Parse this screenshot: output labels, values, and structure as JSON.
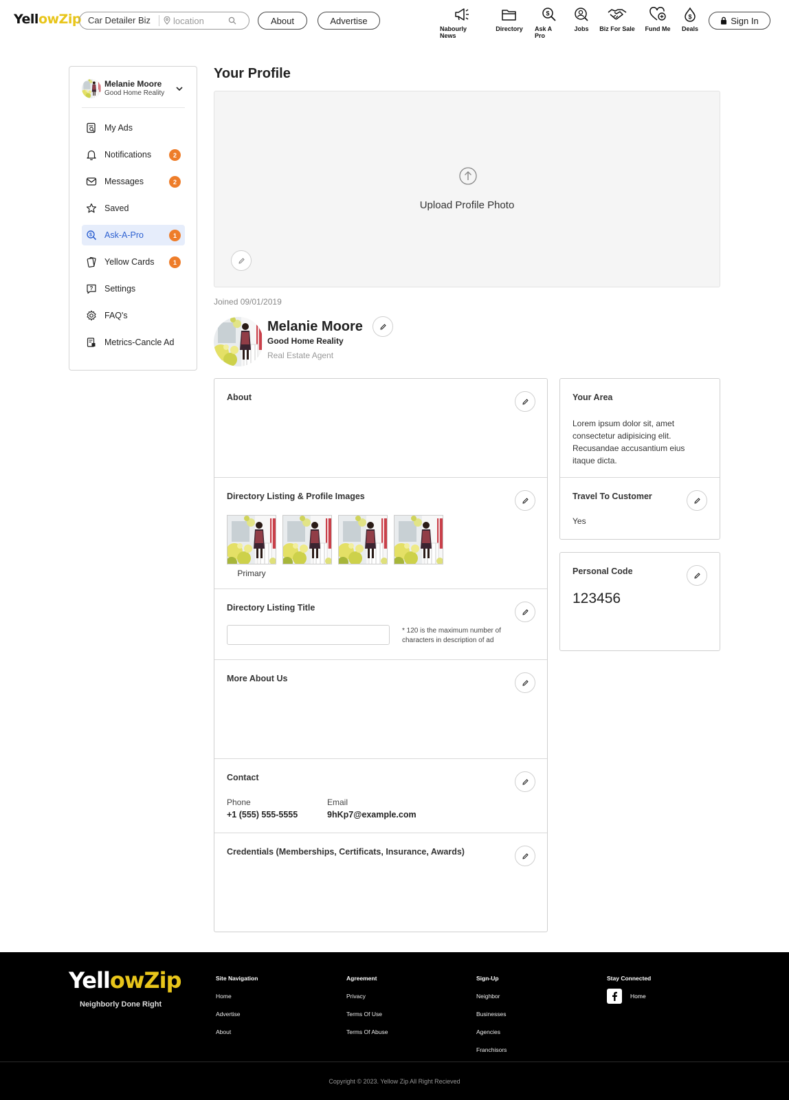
{
  "header": {
    "logo_left": "Yell",
    "logo_mid": "ow",
    "logo_right": "Zip",
    "search_keyword": "Car Detailer Biz",
    "search_location_placeholder": "location",
    "about_label": "About",
    "advertise_label": "Advertise",
    "nav": [
      {
        "label": "Nabourly News",
        "icon": "megaphone-icon"
      },
      {
        "label": "Directory",
        "icon": "folder-icon"
      },
      {
        "label": "Ask A Pro",
        "icon": "dollar-search-icon"
      },
      {
        "label": "Jobs",
        "icon": "user-search-icon"
      },
      {
        "label": "Biz For Sale",
        "icon": "handshake-icon"
      },
      {
        "label": "Fund Me",
        "icon": "heart-plus-icon"
      },
      {
        "label": "Deals",
        "icon": "dollar-drop-icon"
      }
    ],
    "signin_label": "Sign In"
  },
  "sidebar": {
    "user_name": "Melanie Moore",
    "user_company": "Good Home Reality",
    "items": [
      {
        "label": "My Ads",
        "icon": "ads-icon",
        "badge": null,
        "active": false
      },
      {
        "label": "Notifications",
        "icon": "bell-icon",
        "badge": "2",
        "active": false
      },
      {
        "label": "Messages",
        "icon": "envelope-icon",
        "badge": "2",
        "active": false
      },
      {
        "label": "Saved",
        "icon": "star-icon",
        "badge": null,
        "active": false
      },
      {
        "label": "Ask-A-Pro",
        "icon": "dollar-search-icon",
        "badge": "1",
        "active": true
      },
      {
        "label": "Yellow Cards",
        "icon": "cards-icon",
        "badge": "1",
        "active": false
      },
      {
        "label": "Settings",
        "icon": "help-chat-icon",
        "badge": null,
        "active": false
      },
      {
        "label": "FAQ's",
        "icon": "gear-icon",
        "badge": null,
        "active": false
      },
      {
        "label": "Metrics-Cancle Ad",
        "icon": "metrics-icon",
        "badge": null,
        "active": false
      }
    ]
  },
  "main": {
    "page_title": "Your Profile",
    "upload_label": "Upload Profile Photo",
    "joined": "Joined 09/01/2019",
    "profile_name": "Melanie Moore",
    "profile_company": "Good Home Reality",
    "profile_role": "Real Estate Agent",
    "about_title": "About",
    "images_title": "Directory Listing & Profile Images",
    "primary_label": "Primary",
    "listing_title": "Directory Listing Title",
    "listing_hint": "* 120 is the maximum number of characters in description of ad",
    "more_about_title": "More About Us",
    "contact_title": "Contact",
    "phone_label": "Phone",
    "phone_value": "+1 (555) 555-5555",
    "email_label": "Email",
    "email_value": "9hKp7@example.com",
    "credentials_title": "Credentials (Memberships, Certificats, Insurance, Awards)"
  },
  "right": {
    "area_title": "Your Area",
    "area_text": "Lorem ipsum dolor sit, amet consectetur adipisicing elit. Recusandae accusantium eius itaque dicta.",
    "travel_title": "Travel To Customer",
    "travel_value": "Yes",
    "code_title": "Personal Code",
    "code_value": "123456"
  },
  "footer": {
    "tagline": "Neighborly Done Right",
    "cols": [
      {
        "heading": "Site Navigation",
        "links": [
          "Home",
          "Advertise",
          "About"
        ]
      },
      {
        "heading": "Agreement",
        "links": [
          "Privacy",
          "Terms Of Use",
          "Terms Of Abuse"
        ]
      },
      {
        "heading": "Sign-Up",
        "links": [
          "Neighbor",
          "Businesses",
          "Agencies",
          "Franchisors"
        ]
      }
    ],
    "stay_heading": "Stay Connected",
    "stay_link": "Home",
    "copyright": "Copyright © 2023. Yellow Zip All Right Recieved"
  },
  "colors": {
    "accent": "#ee7d2a",
    "active_bg": "#e6edfb",
    "active_text": "#2b5fd0",
    "logo_yellow": "#e8c51a"
  }
}
